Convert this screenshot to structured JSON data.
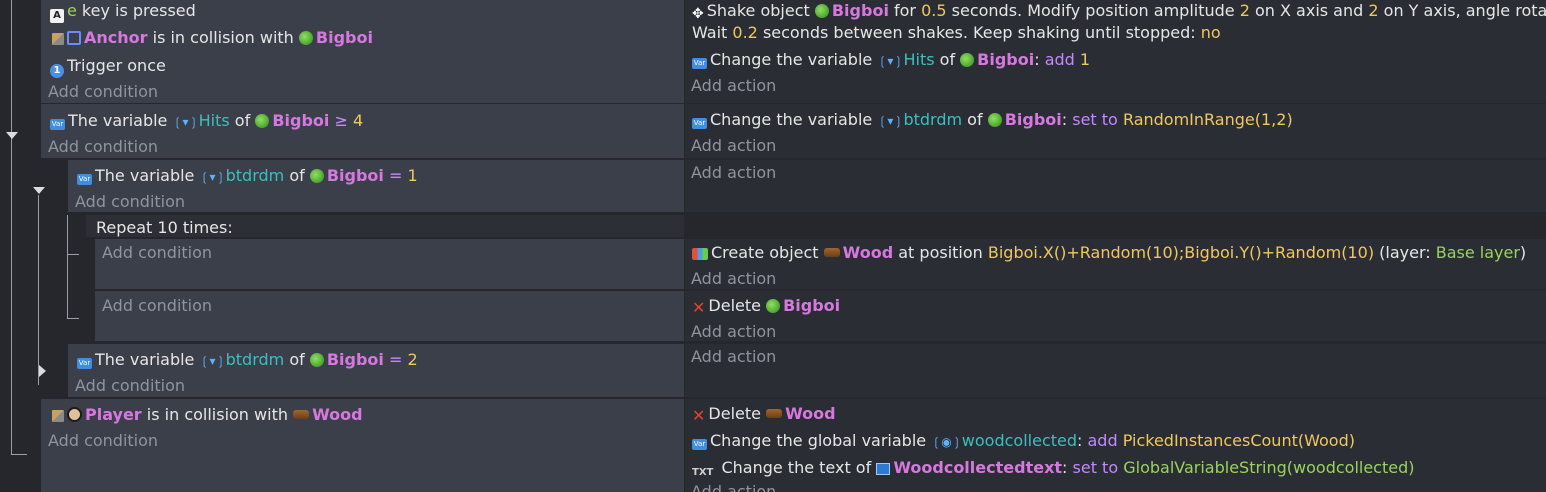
{
  "placeholders": {
    "add_condition": "Add condition",
    "add_action": "Add action"
  },
  "events": {
    "e1": {
      "conditions": {
        "key": {
          "key": "e",
          "text": " key is pressed"
        },
        "collision": {
          "object": "Anchor",
          "mid": " is in collision with ",
          "target": "Bigboi"
        },
        "trigger": {
          "text": "Trigger once"
        }
      },
      "actions": {
        "shake": {
          "l1_a": "Shake object ",
          "object": "Bigboi",
          "l1_b": " for ",
          "duration": "0.5",
          "l1_c": " seconds. Modify position amplitude ",
          "ampx": "2",
          "l1_d": " on X axis and ",
          "ampy": "2",
          "l1_e": " on Y axis, angle rotation",
          "l2_a": "Wait ",
          "wait": "0.2",
          "l2_b": " seconds between shakes. Keep shaking until stopped: ",
          "keep": "no"
        },
        "change_hits": {
          "a": "Change the variable ",
          "var": "Hits",
          "of": " of ",
          "object": "Bigboi",
          "colon": ": ",
          "op": "add",
          "value": "1"
        }
      }
    },
    "e2": {
      "condition": {
        "a": "The variable ",
        "var": "Hits",
        "of": " of ",
        "object": "Bigboi",
        "op": "≥",
        "value": "4"
      },
      "action": {
        "a": "Change the variable ",
        "var": "btdrdm",
        "of": " of ",
        "object": "Bigboi",
        "colon": ": ",
        "op": "set to",
        "value": "RandomInRange(1,2)"
      }
    },
    "e3": {
      "condition": {
        "a": "The variable ",
        "var": "btdrdm",
        "of": " of ",
        "object": "Bigboi",
        "op": "=",
        "value": "1"
      },
      "repeat": "Repeat 10 times:",
      "create": {
        "a": "Create object ",
        "object": "Wood",
        "b": " at position ",
        "value": "Bigboi.X()+Random(10);Bigboi.Y()+Random(10)",
        "c": " (layer: ",
        "layer": "Base layer",
        "d": ")"
      },
      "delete": {
        "a": "Delete ",
        "object": "Bigboi"
      }
    },
    "e4": {
      "condition": {
        "a": "The variable ",
        "var": "btdrdm",
        "of": " of ",
        "object": "Bigboi",
        "op": "=",
        "value": "2"
      }
    },
    "e5": {
      "condition": {
        "object": "Player",
        "mid": " is in collision with ",
        "target": "Wood"
      },
      "delete": {
        "a": "Delete ",
        "object": "Wood"
      },
      "change_global": {
        "a": "Change the global variable ",
        "var": "woodcollected",
        "colon": ": ",
        "op": "add",
        "value": "PickedInstancesCount(Wood)"
      },
      "change_text": {
        "a": "Change the text of ",
        "object": "Woodcollectedtext",
        "colon": ": ",
        "op": "set to",
        "value": "GlobalVariableString(woodcollected)"
      }
    }
  },
  "colors": {
    "condition_bg": "#3b3f4a",
    "action_bg": "#2a2d33",
    "object": "#d678e0",
    "variable": "#39c0c0",
    "operator": "#c488ff",
    "number": "#f0c860",
    "string": "#9ad35e"
  }
}
